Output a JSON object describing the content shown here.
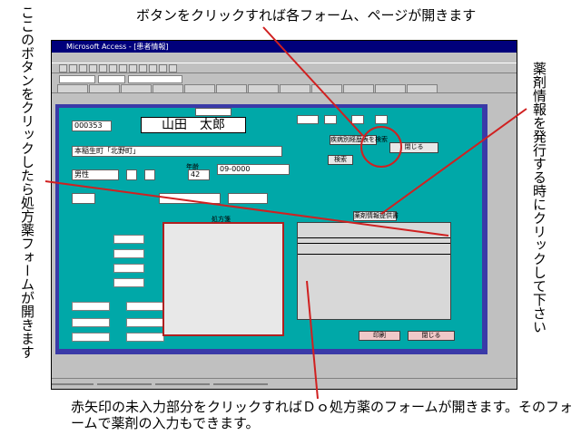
{
  "annotations": {
    "top": "ボタンをクリックすれば各フォーム、ページが開きます",
    "left_col1": "ここのボタンをクリックしたら処方薬フォームが開きます",
    "right_col1": "薬剤情報を発行する時にクリックして下さい",
    "bottom": "赤矢印の未入力部分をクリックすればＤｏ処方薬のフォームが開きます。そのフォームで薬剤の入力もできます。"
  },
  "window": {
    "title": "Microsoft Access - [患者情報]"
  },
  "form": {
    "patient_id": "000353",
    "patient_name": "山田　太郎",
    "address": "本稲生町「北野町」",
    "phone": "09-0000",
    "gender": "男性",
    "age_label": "年齢",
    "age": "42",
    "insurance_button": "疾病別経歴表を検索",
    "search_button": "検索",
    "drug_info_button": "薬剤情報提供書",
    "close_button": "閉じる",
    "print_button": "印刷",
    "prescription_label": "処方箋"
  },
  "colors": {
    "panel": "#00a8a8",
    "frame": "#3a3aa8",
    "title": "#00007b",
    "arrow": "#d02020"
  }
}
